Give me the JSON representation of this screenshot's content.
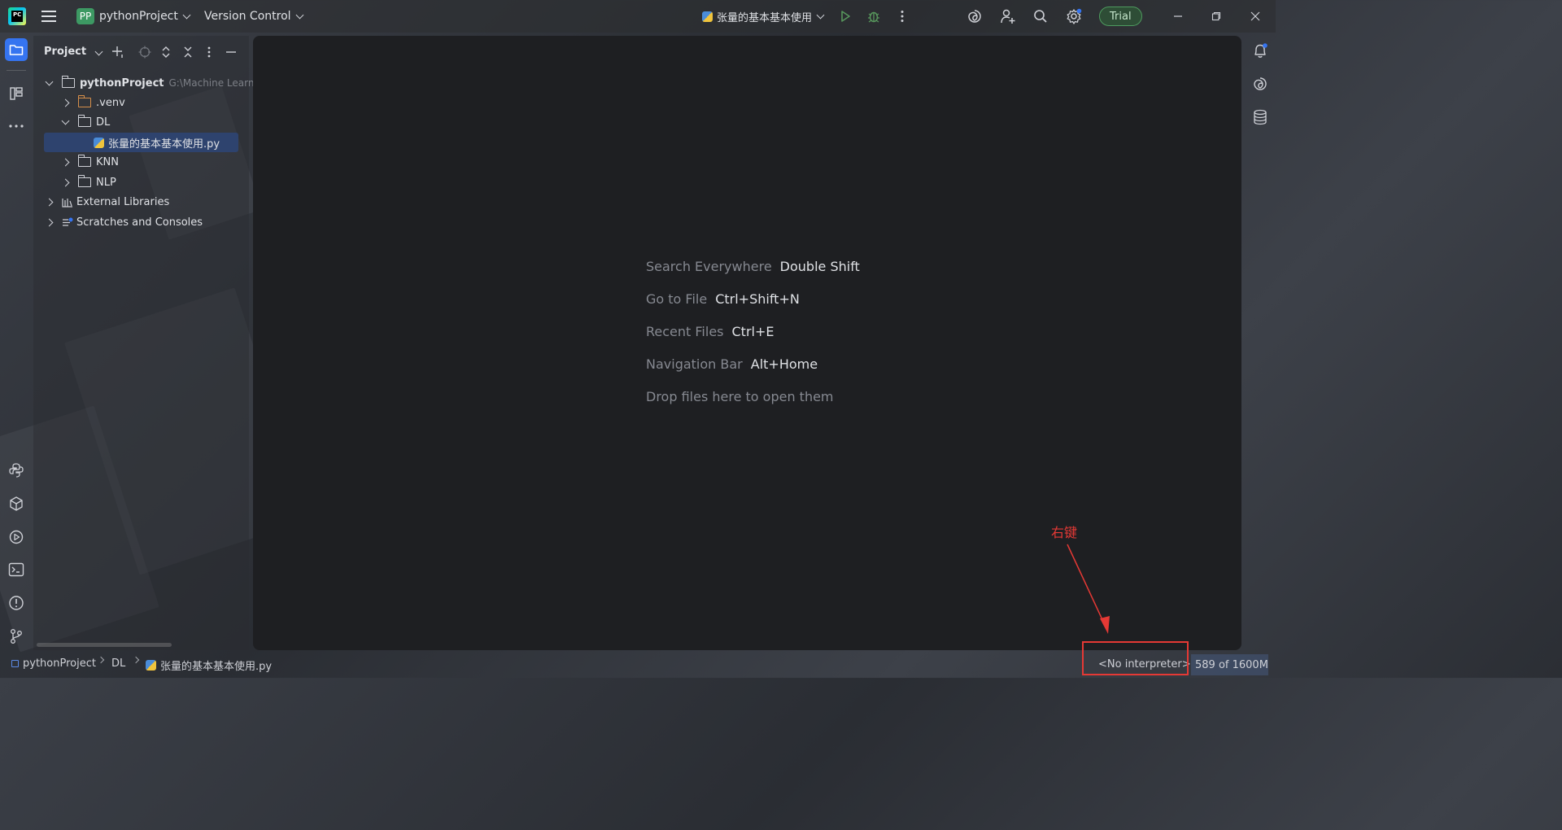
{
  "titlebar": {
    "project_badge": "PP",
    "project_name": "pythonProject",
    "vcs_label": "Version Control",
    "run_config": "张量的基本基本使用",
    "trial_label": "Trial"
  },
  "project_panel": {
    "title": "Project",
    "tree": [
      {
        "label": "pythonProject",
        "hint": "G:\\Machine Learnin"
      },
      {
        "label": ".venv"
      },
      {
        "label": "DL"
      },
      {
        "label": "张量的基本基本使用.py"
      },
      {
        "label": "KNN"
      },
      {
        "label": "NLP"
      },
      {
        "label": "External Libraries"
      },
      {
        "label": "Scratches and Consoles"
      }
    ]
  },
  "editor": {
    "hints": [
      {
        "label": "Search Everywhere",
        "key": "Double Shift"
      },
      {
        "label": "Go to File",
        "key": "Ctrl+Shift+N"
      },
      {
        "label": "Recent Files",
        "key": "Ctrl+E"
      },
      {
        "label": "Navigation Bar",
        "key": "Alt+Home"
      }
    ],
    "drop_hint": "Drop files here to open them"
  },
  "statusbar": {
    "breadcrumb": [
      "pythonProject",
      "DL",
      "张量的基本基本使用.py"
    ],
    "interpreter": "<No interpreter>",
    "memory": "589 of 1600M"
  },
  "annotation": {
    "text": "右键",
    "color": "#e53935"
  },
  "colors": {
    "accent": "#3574f0",
    "selection": "#2e436e",
    "trial_green": "#4e9a5f",
    "run_green": "#57965c"
  }
}
